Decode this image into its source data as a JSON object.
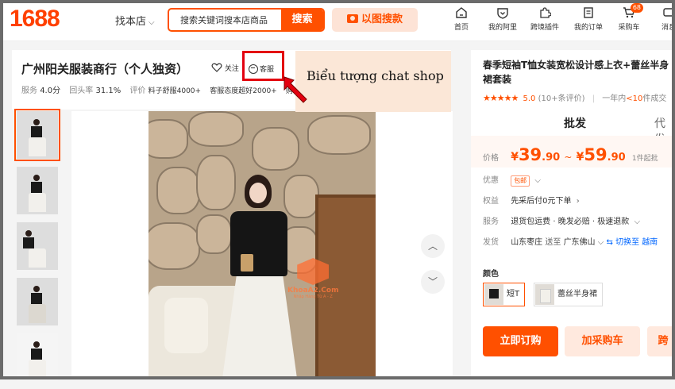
{
  "header": {
    "logo": "1688",
    "find_shop": "找本店",
    "search_placeholder": "搜索关键词搜本店商品",
    "search_button": "搜索",
    "image_search": "以图搜款",
    "nav": [
      {
        "label": "首页",
        "icon": "home-icon"
      },
      {
        "label": "我的阿里",
        "icon": "heart-shield-icon"
      },
      {
        "label": "跨境插件",
        "icon": "puzzle-icon"
      },
      {
        "label": "我的订单",
        "icon": "order-icon"
      },
      {
        "label": "采购车",
        "icon": "cart-icon",
        "badge": "68"
      },
      {
        "label": "消息",
        "icon": "message-icon"
      }
    ]
  },
  "shop": {
    "name": "广州阳关服装商行（个人独资）",
    "follow": "关注",
    "customer_service": "客服",
    "stats": {
      "service_label": "服务",
      "service_value": "4.0分",
      "repeat_label": "回头率",
      "repeat_value": "31.1%",
      "review_label": "评价",
      "tag1": "料子舒服4000+",
      "tag2": "客服态度超好2000+",
      "tag3": "购"
    }
  },
  "annotation": {
    "text": "Biểu tượng chat shop",
    "highlight_color": "#e3000f"
  },
  "gallery": {
    "thumb_count": 5,
    "watermark": "KhoaA2.Com",
    "watermark_sub": "Nhập Hàng Từ A - Z",
    "up_arrow": "︿",
    "down_arrow": "﹀"
  },
  "product": {
    "title": "春季短袖T恤女装宽松设计感上衣+蕾丝半身裙套装",
    "stars": "★★★★★",
    "rating": "5.0",
    "review_count": "(10+条评价)",
    "sales_prefix": "一年内",
    "sales_value": "<10",
    "sales_suffix": "件成交",
    "tab_active": "批发",
    "tab_other": "代发",
    "price_label": "价格",
    "price_currency": "¥",
    "price_low_int": "39",
    "price_low_dec": ".90",
    "price_tilde": "~",
    "price_high_int": "59",
    "price_high_dec": ".90",
    "min_order": "1件起批",
    "discount_label": "优惠",
    "discount_tag": "包邮",
    "rights_label": "权益",
    "rights_value": "先采后付0元下单",
    "service_label": "服务",
    "service_value": "退货包运费 · 晚发必赔 · 极速退款",
    "ship_label": "发货",
    "ship_from": "山东枣庄",
    "ship_to_word": "送至",
    "ship_to": "广东佛山",
    "ship_switch": "切换至 越南",
    "color_label": "颜色",
    "variants": [
      "短T",
      "蕾丝半身裙"
    ],
    "buy_now": "立即订购",
    "add_cart": "加采购车",
    "more": "跨"
  },
  "colors": {
    "brand": "#ff5000",
    "callout_bg": "#fbe7d7"
  }
}
